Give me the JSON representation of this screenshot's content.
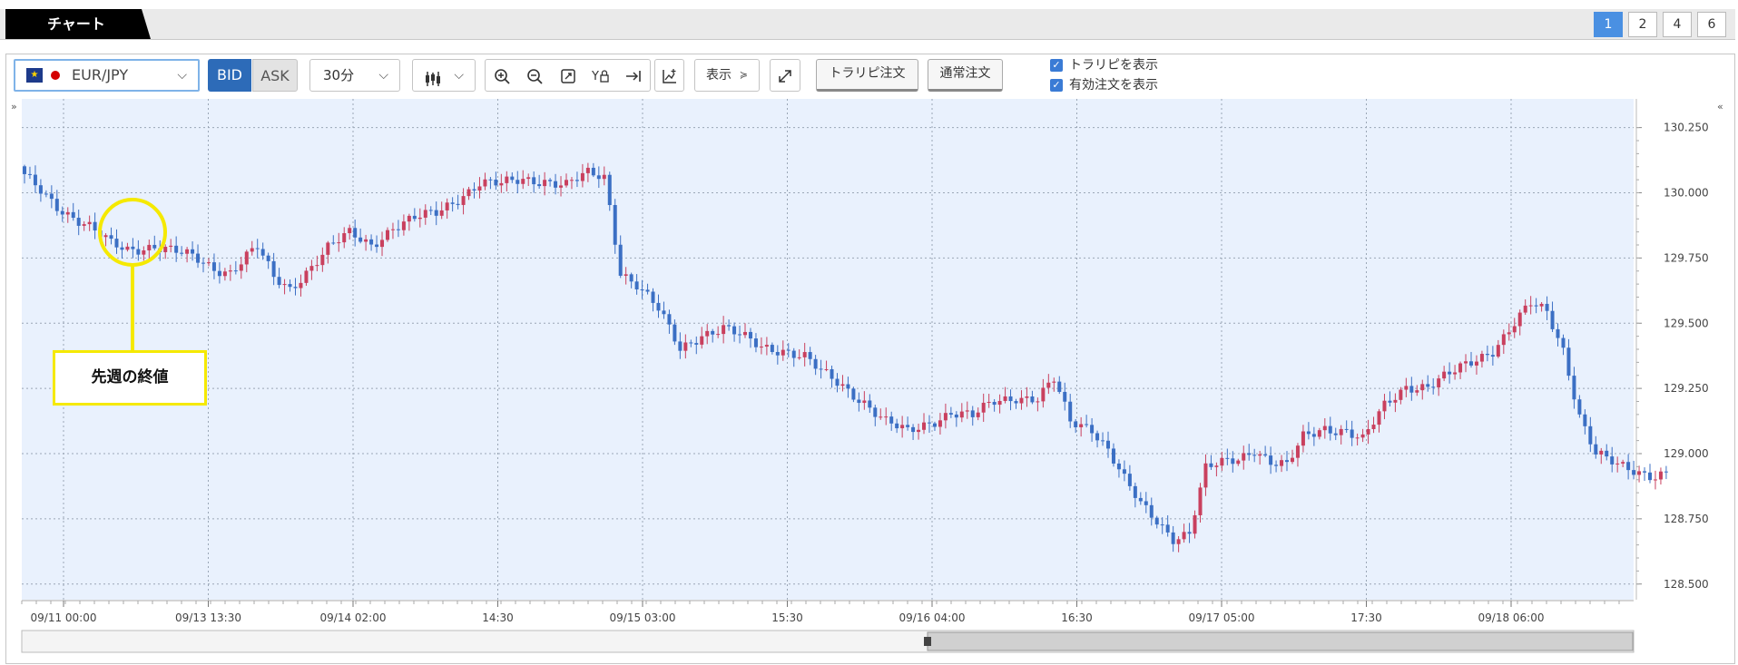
{
  "tabs": {
    "active_label": "チャート"
  },
  "pages": [
    {
      "label": "1",
      "active": true
    },
    {
      "label": "2",
      "active": false
    },
    {
      "label": "4",
      "active": false
    },
    {
      "label": "6",
      "active": false
    }
  ],
  "toolbar": {
    "symbol": "EUR/JPY",
    "bid_label": "BID",
    "ask_label": "ASK",
    "timeframe": "30分",
    "display_label": "表示",
    "order_trap_label": "トラリピ注文",
    "order_normal_label": "通常注文",
    "check_show_trap": "トラリピを表示",
    "check_show_orders": "有効注文を表示",
    "icons": [
      "candlestick-icon",
      "zoom-in-icon",
      "zoom-out-icon",
      "fit-icon",
      "y-lock-icon",
      "scroll-end-icon",
      "indicator-icon",
      "expand-icon"
    ]
  },
  "annotation": {
    "label": "先週の終値",
    "color": "#f5e900"
  },
  "colors": {
    "up": "#c9405e",
    "down": "#3b6fc4",
    "plot_bg": "#e9f1fd",
    "accent": "#2d6bb8"
  },
  "chart_data": {
    "type": "candlestick",
    "title": "",
    "symbol": "EUR/JPY",
    "timeframe": "30分",
    "ylim": [
      128.44,
      130.36
    ],
    "y_ticks": [
      "130.250",
      "130.000",
      "129.750",
      "129.500",
      "129.250",
      "129.000",
      "128.750",
      "128.500"
    ],
    "x_ticks": [
      "09/11 00:00",
      "09/13 13:30",
      "09/14 02:00",
      "14:30",
      "09/15 03:00",
      "15:30",
      "09/16 04:00",
      "16:30",
      "09/17 05:00",
      "17:30",
      "09/18 06:00"
    ],
    "grid": true,
    "close_path": [
      [
        0,
        130.06
      ],
      [
        6,
        129.95
      ],
      [
        12,
        129.87
      ],
      [
        16,
        129.8
      ],
      [
        19,
        129.78
      ],
      [
        24,
        129.8
      ],
      [
        27,
        129.78
      ],
      [
        31,
        129.75
      ],
      [
        35,
        129.71
      ],
      [
        38,
        129.7
      ],
      [
        41,
        129.76
      ],
      [
        43,
        129.79
      ],
      [
        46,
        129.67
      ],
      [
        49,
        129.63
      ],
      [
        52,
        129.7
      ],
      [
        56,
        129.79
      ],
      [
        60,
        129.84
      ],
      [
        64,
        129.8
      ],
      [
        68,
        129.87
      ],
      [
        72,
        129.9
      ],
      [
        76,
        129.92
      ],
      [
        80,
        129.98
      ],
      [
        84,
        130.04
      ],
      [
        88,
        130.03
      ],
      [
        92,
        130.05
      ],
      [
        96,
        130.05
      ],
      [
        100,
        130.03
      ],
      [
        104,
        130.07
      ],
      [
        107,
        130.06
      ],
      [
        108,
        129.95
      ],
      [
        110,
        129.7
      ],
      [
        113,
        129.65
      ],
      [
        117,
        129.55
      ],
      [
        121,
        129.4
      ],
      [
        125,
        129.46
      ],
      [
        129,
        129.48
      ],
      [
        132,
        129.45
      ],
      [
        136,
        129.41
      ],
      [
        140,
        129.4
      ],
      [
        144,
        129.37
      ],
      [
        147,
        129.31
      ],
      [
        151,
        129.26
      ],
      [
        155,
        129.2
      ],
      [
        159,
        129.12
      ],
      [
        163,
        129.08
      ],
      [
        167,
        129.12
      ],
      [
        171,
        129.16
      ],
      [
        175,
        129.14
      ],
      [
        179,
        129.2
      ],
      [
        183,
        129.22
      ],
      [
        187,
        129.21
      ],
      [
        190,
        129.28
      ],
      [
        193,
        129.12
      ],
      [
        197,
        129.1
      ],
      [
        200,
        129.02
      ],
      [
        203,
        128.9
      ],
      [
        206,
        128.8
      ],
      [
        209,
        128.74
      ],
      [
        212,
        128.68
      ],
      [
        215,
        128.7
      ],
      [
        218,
        128.94
      ],
      [
        221,
        128.96
      ],
      [
        224,
        128.98
      ],
      [
        227,
        129.02
      ],
      [
        230,
        128.97
      ],
      [
        233,
        128.95
      ],
      [
        236,
        129.06
      ],
      [
        240,
        129.1
      ],
      [
        244,
        129.09
      ],
      [
        247,
        129.05
      ],
      [
        251,
        129.18
      ],
      [
        255,
        129.26
      ],
      [
        259,
        129.26
      ],
      [
        263,
        129.3
      ],
      [
        267,
        129.35
      ],
      [
        271,
        129.4
      ],
      [
        275,
        129.5
      ],
      [
        278,
        129.57
      ],
      [
        281,
        129.54
      ],
      [
        284,
        129.4
      ],
      [
        287,
        129.15
      ],
      [
        290,
        129.0
      ],
      [
        294,
        128.95
      ],
      [
        298,
        128.93
      ],
      [
        301,
        128.92
      ],
      [
        303,
        128.93
      ]
    ]
  }
}
